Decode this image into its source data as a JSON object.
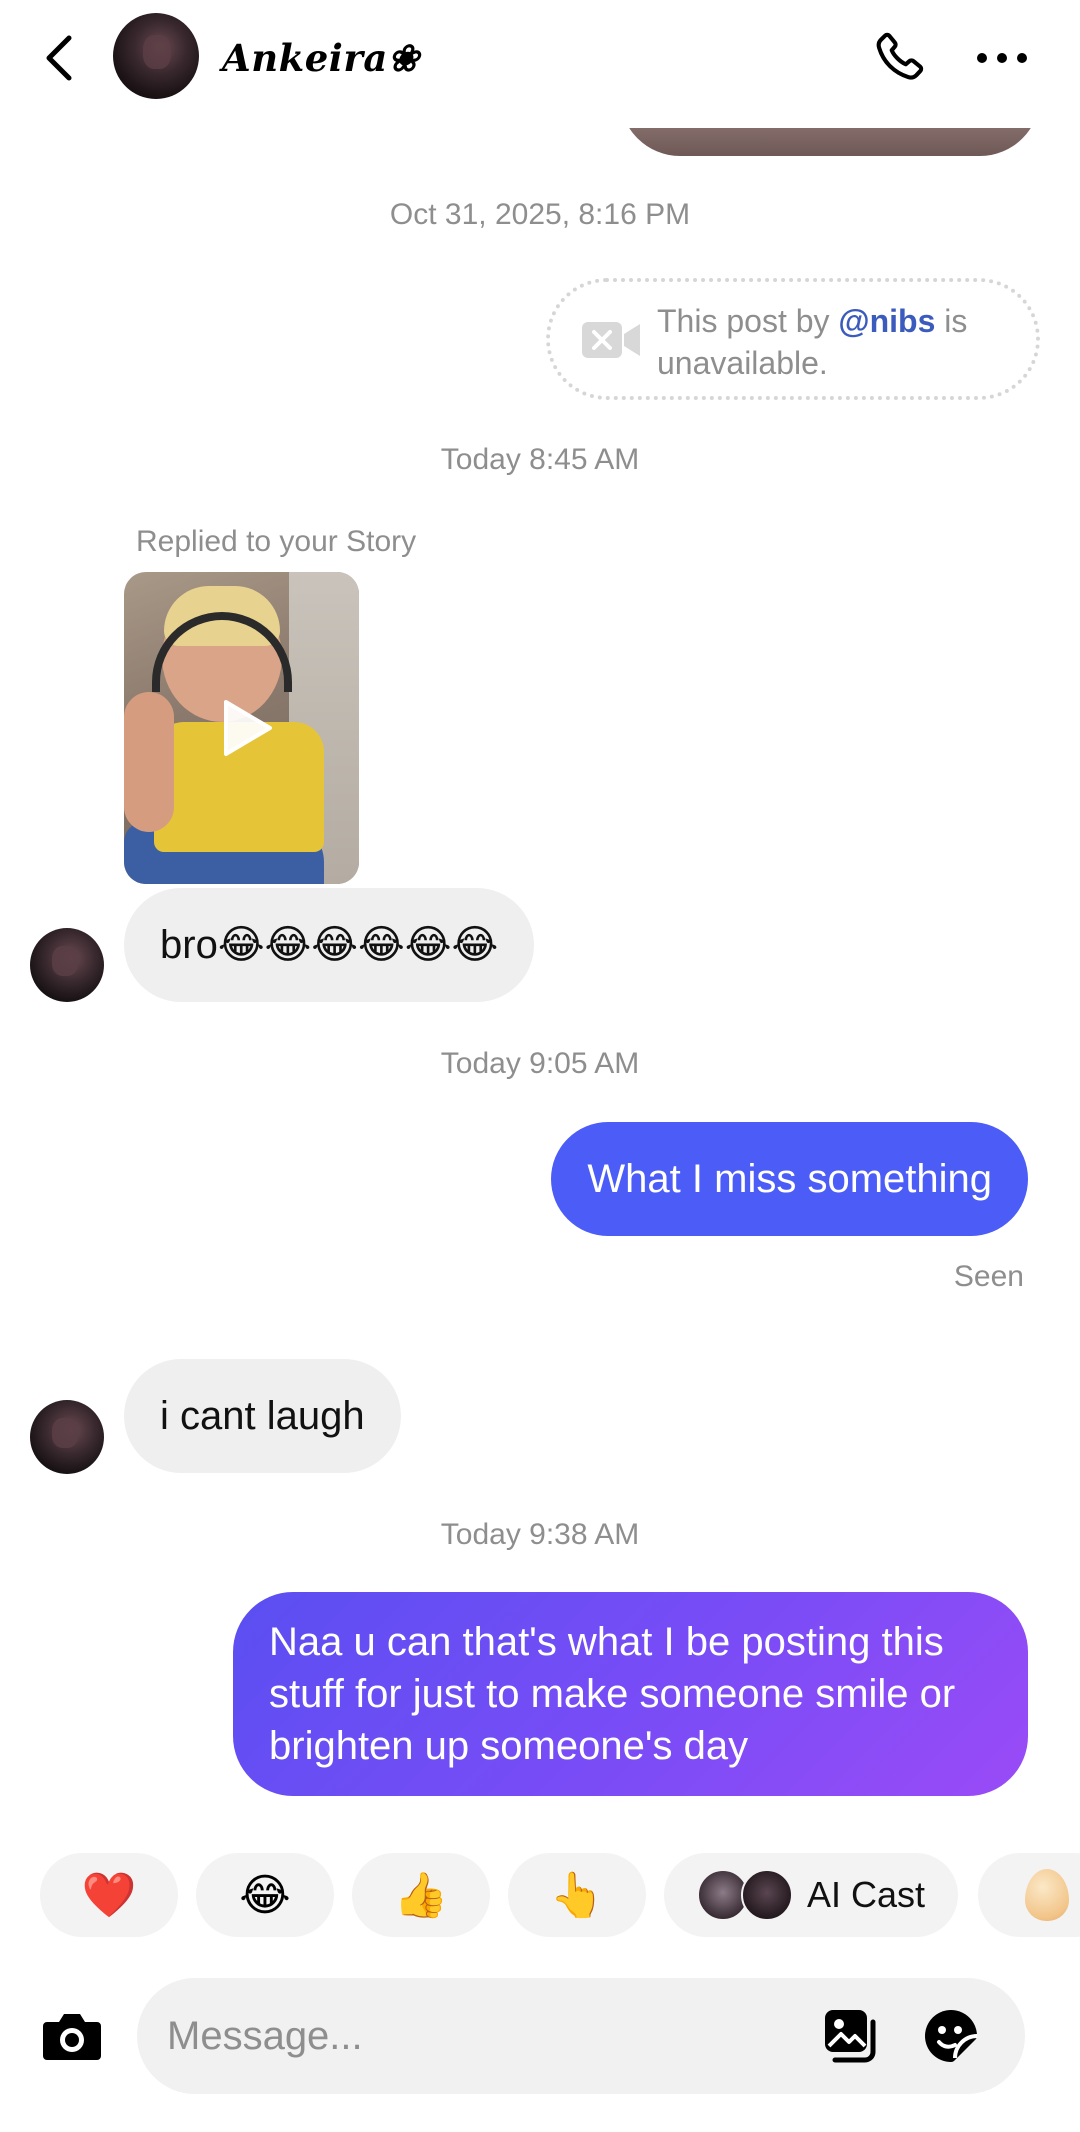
{
  "header": {
    "contact_name": "Ankeira❀",
    "back_icon": "chevron-left-icon",
    "call_icon": "phone-icon",
    "more_icon": "more-horizontal-icon"
  },
  "messages": {
    "ts_1": "Oct 31, 2025, 8:16 PM",
    "unavailable_prefix": "This post by",
    "unavailable_mention": "@nibs",
    "unavailable_suffix": "is unavailable.",
    "ts_2": "Today 8:45 AM",
    "story_reply_label": "Replied to your Story",
    "in_1": "bro😂😂😂😂😂😂",
    "ts_3": "Today 9:05 AM",
    "out_1": "What I miss something",
    "seen": "Seen",
    "in_2": "i cant laugh",
    "ts_4": "Today 9:38 AM",
    "out_2": "Naa u can that's what I be posting this stuff for just to make someone smile or brighten up someone's day"
  },
  "quick_replies": {
    "heart": "❤️",
    "laugh": "😂",
    "thumbs_up": "👍",
    "point": "👆",
    "ai_cast": "AI Cast"
  },
  "composer": {
    "placeholder": "Message..."
  },
  "colors": {
    "outgoing_blue": "#4b5cf7",
    "outgoing_purple": "#7a4cf6",
    "incoming_bg": "#efefef",
    "mention": "#3b5bbd"
  }
}
